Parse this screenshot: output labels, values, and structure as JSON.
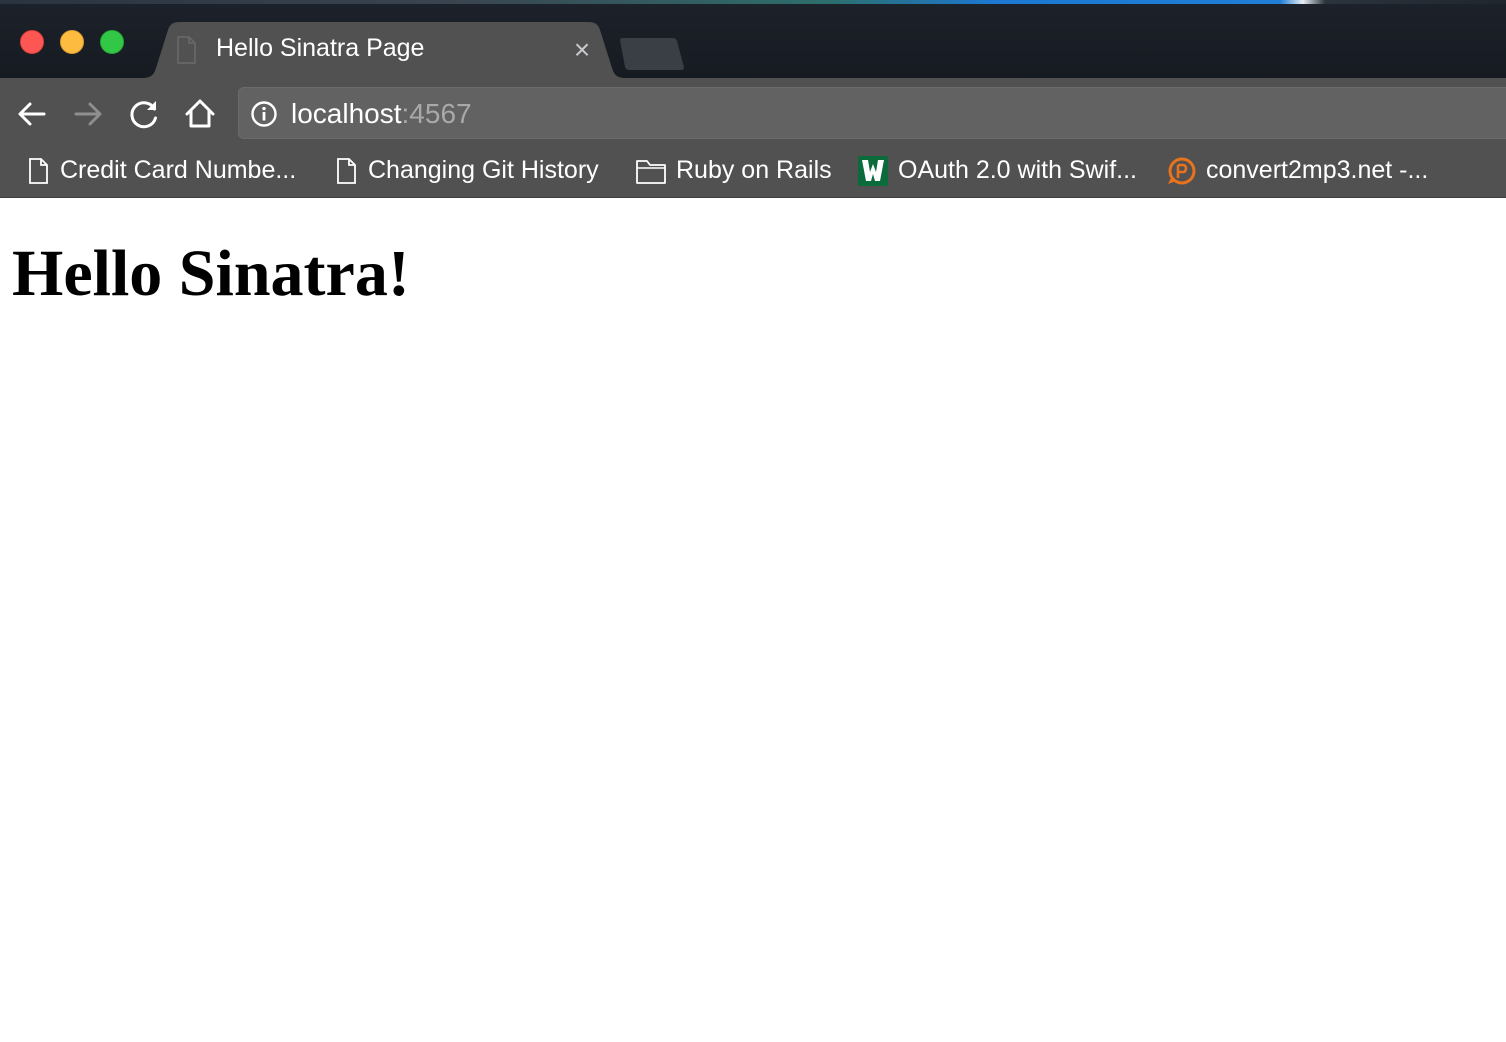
{
  "browser": {
    "tab": {
      "title": "Hello Sinatra Page",
      "close_glyph": "×",
      "favicon": "blank-document-icon"
    },
    "toolbar": {
      "back_icon": "arrow-left-icon",
      "forward_icon": "arrow-right-icon",
      "reload_icon": "reload-icon",
      "home_icon": "home-icon",
      "site_info_icon": "info-icon"
    },
    "address_bar": {
      "host": "localhost",
      "port": ":4567"
    },
    "bookmarks": [
      {
        "label": "Credit Card Numbe...",
        "icon": "document-icon"
      },
      {
        "label": "Changing Git History",
        "icon": "document-icon"
      },
      {
        "label": "Ruby on Rails",
        "icon": "folder-icon"
      },
      {
        "label": "OAuth 2.0 with Swif...",
        "icon": "green-site-icon"
      },
      {
        "label": "convert2mp3.net -...",
        "icon": "orange-site-icon"
      }
    ]
  },
  "page": {
    "heading": "Hello Sinatra!"
  },
  "colors": {
    "titlebar": "#1d222a",
    "toolbar": "#515151",
    "omnibox": "#626262",
    "close_red": "#fc5753",
    "minimize_yellow": "#fdbc40",
    "zoom_green": "#33c748",
    "orange_bookmark": "#e8731c",
    "green_bookmark": "#0b6b3a"
  }
}
